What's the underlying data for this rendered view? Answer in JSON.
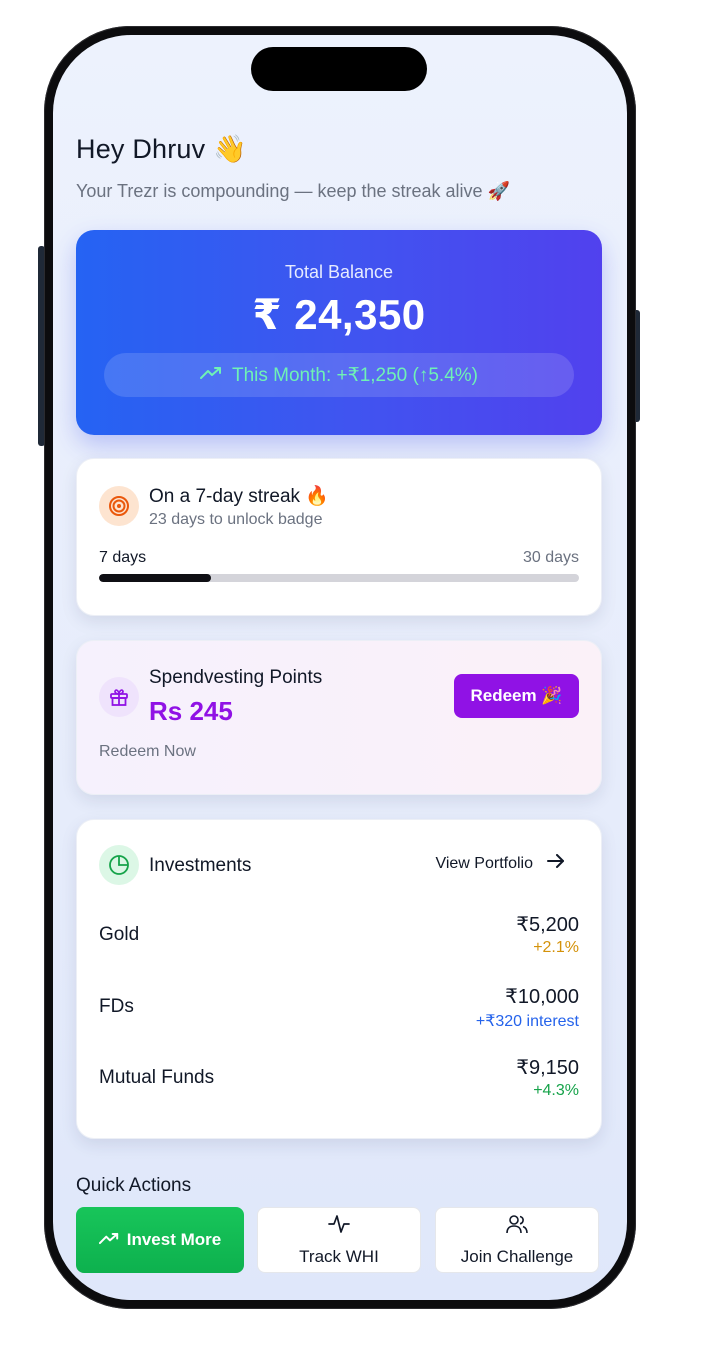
{
  "greeting": {
    "title": "Hey Dhruv 👋",
    "subtitle": "Your Trezr is compounding — keep the streak alive 🚀"
  },
  "balance": {
    "label": "Total Balance",
    "amount": "₹ 24,350",
    "month_change": "This Month: +₹1,250 (↑5.4%)"
  },
  "streak": {
    "title": "On a 7-day streak 🔥",
    "subtitle": "23 days to unlock badge",
    "start_label": "7 days",
    "end_label": "30 days",
    "progress_fraction": 0.233
  },
  "points": {
    "title": "Spendvesting Points",
    "value": "Rs 245",
    "redeem_label": "Redeem 🎉",
    "redeem_now": "Redeem Now"
  },
  "investments": {
    "title": "Investments",
    "view_portfolio": "View Portfolio",
    "items": [
      {
        "name": "Gold",
        "amount": "₹5,200",
        "change": "+2.1%",
        "color": "#d4920a"
      },
      {
        "name": "FDs",
        "amount": "₹10,000",
        "change": "+₹320 interest",
        "color": "#2563eb"
      },
      {
        "name": "Mutual Funds",
        "amount": "₹9,150",
        "change": "+4.3%",
        "color": "#16a34a"
      }
    ]
  },
  "quick_actions": {
    "title": "Quick Actions",
    "invest_more": "Invest More",
    "track_whi": "Track WHI",
    "join_challenge": "Join Challenge"
  },
  "colors": {
    "balance_gradient_start": "#2563f3",
    "balance_gradient_end": "#5141ee",
    "points_accent": "#9012e5",
    "invest_button": "#16a34a",
    "month_change_text": "#6ff2b5"
  }
}
